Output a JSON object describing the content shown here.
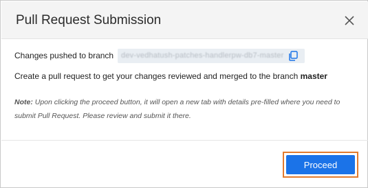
{
  "dialog": {
    "title": "Pull Request Submission",
    "close_icon": "close-icon"
  },
  "branch": {
    "label": "Changes pushed to branch",
    "name": "dev-vedhatush-patches-handlerpw-db7-master",
    "copy_icon": "copy-icon"
  },
  "description": {
    "text": "Create a pull request to get your changes reviewed and merged to the branch ",
    "target_branch": "master"
  },
  "note": {
    "label": "Note:",
    "text": " Upon clicking the proceed button, it will open a new tab with details pre-filled where you need to submit Pull Request. Please review and submit it there."
  },
  "footer": {
    "proceed_label": "Proceed"
  },
  "colors": {
    "primary": "#1b73e8",
    "focus_outline": "#e37a2c",
    "header_bg": "#f4f4f4"
  }
}
